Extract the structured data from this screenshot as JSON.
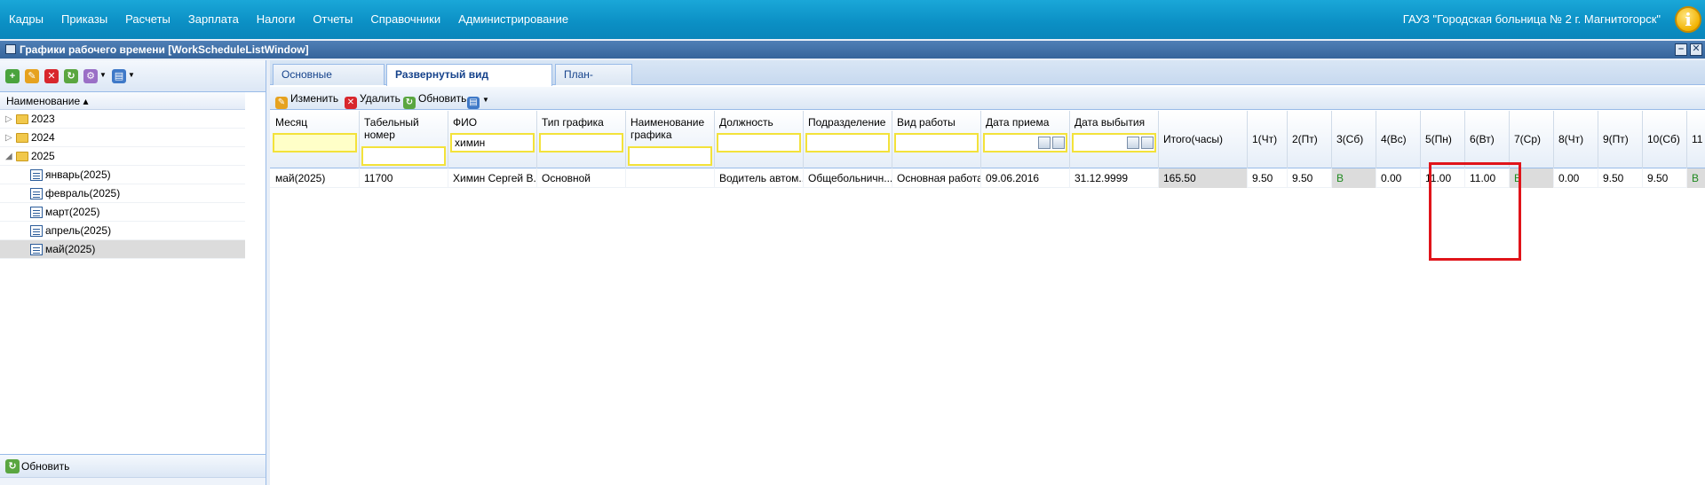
{
  "menu": [
    "Кадры",
    "Приказы",
    "Расчеты",
    "Зарплата",
    "Налоги",
    "Отчеты",
    "Справочники",
    "Администрирование"
  ],
  "org_name": "ГАУЗ \"Городская больница № 2 г. Магнитогорск\"",
  "window_title": "Графики рабочего времени [WorkScheduleListWindow]",
  "left": {
    "column_header": "Наименование ▴",
    "tree": [
      {
        "label": "2023",
        "type": "folder",
        "expanded": false
      },
      {
        "label": "2024",
        "type": "folder",
        "expanded": false
      },
      {
        "label": "2025",
        "type": "folder",
        "expanded": true
      },
      {
        "label": "январь(2025)",
        "type": "item"
      },
      {
        "label": "февраль(2025)",
        "type": "item"
      },
      {
        "label": "март(2025)",
        "type": "item"
      },
      {
        "label": "апрель(2025)",
        "type": "item"
      },
      {
        "label": "май(2025)",
        "type": "item",
        "selected": true
      }
    ],
    "refresh_label": "Обновить"
  },
  "tabs": [
    "Основные реквизиты",
    "Развернутый вид (периоды)",
    "План-график"
  ],
  "active_tab": 1,
  "toolbar": {
    "edit": "Изменить",
    "delete": "Удалить",
    "refresh": "Обновить"
  },
  "grid": {
    "columns": [
      {
        "label": "Месяц",
        "filter": ""
      },
      {
        "label": "Табельный номер",
        "filter": ""
      },
      {
        "label": "ФИО",
        "filter": "химин"
      },
      {
        "label": "Тип графика",
        "filter": ""
      },
      {
        "label": "Наименование графика",
        "filter": ""
      },
      {
        "label": "Должность",
        "filter": ""
      },
      {
        "label": "Подразделение",
        "filter": ""
      },
      {
        "label": "Вид работы",
        "filter": ""
      },
      {
        "label": "Дата приема",
        "filter": ""
      },
      {
        "label": "Дата выбытия",
        "filter": ""
      },
      {
        "label": "Итого(часы)"
      },
      {
        "label": "1(Чт)"
      },
      {
        "label": "2(Пт)"
      },
      {
        "label": "3(Сб)"
      },
      {
        "label": "4(Вс)"
      },
      {
        "label": "5(Пн)"
      },
      {
        "label": "6(Вт)"
      },
      {
        "label": "7(Ср)"
      },
      {
        "label": "8(Чт)"
      },
      {
        "label": "9(Пт)"
      },
      {
        "label": "10(Сб)"
      },
      {
        "label": "11"
      }
    ],
    "row": [
      "май(2025)",
      "11700",
      "Химин Сергей В...",
      "Основной",
      "",
      "Водитель автом...",
      "Общебольничн...",
      "Основная работа",
      "09.06.2016",
      "31.12.9999",
      "165.50",
      "9.50",
      "9.50",
      "В",
      "0.00",
      "11.00",
      "11.00",
      "В",
      "0.00",
      "9.50",
      "9.50",
      "В"
    ]
  }
}
